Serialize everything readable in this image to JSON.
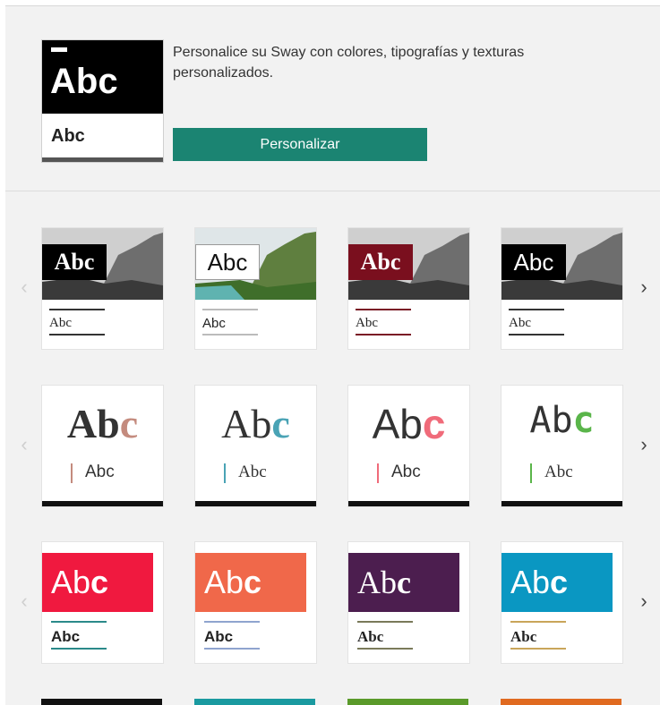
{
  "header": {
    "thumb_big": "Abc",
    "thumb_small": "Abc",
    "description": "Personalice su Sway con colores, tipografías y texturas personalizados.",
    "button_label": "Personalizar",
    "button_color": "#1b8472"
  },
  "nav": {
    "prev_icon": "chevron-left-icon",
    "next_icon": "chevron-right-icon",
    "prev_glyph": "‹",
    "next_glyph": "›"
  },
  "rows": [
    {
      "cards": [
        {
          "label": "Abc",
          "sub": "Abc",
          "accent": "#333333",
          "tag_bg": "#000000"
        },
        {
          "label": "Abc",
          "sub": "Abc",
          "accent": "#bbbbbb",
          "tag_bg": "#ffffff"
        },
        {
          "label": "Abc",
          "sub": "Abc",
          "accent": "#7a1b26",
          "tag_bg": "#7a0f1e"
        },
        {
          "label": "Abc",
          "sub": "Abc",
          "accent": "#333333",
          "tag_bg": "#000000"
        }
      ]
    },
    {
      "cards": [
        {
          "label_main": "Ab",
          "label_accent": "c",
          "sub": "Abc",
          "accent": "#c48b7e"
        },
        {
          "label_main": "Ab",
          "label_accent": "c",
          "sub": "Abc",
          "accent": "#4aa3b5"
        },
        {
          "label_main": "Ab",
          "label_accent": "c",
          "sub": "Abc",
          "accent": "#f06b7a"
        },
        {
          "label_main": "Ab",
          "label_accent": "c",
          "sub": "Abc",
          "accent": "#5ab54a"
        }
      ]
    },
    {
      "cards": [
        {
          "label_main": "Ab",
          "label_accent": "c",
          "sub": "Abc",
          "block": "#f0193f",
          "accent": "#2b8a8a"
        },
        {
          "label_main": "Ab",
          "label_accent": "c",
          "sub": "Abc",
          "block": "#f0684a",
          "accent": "#8fa4cf"
        },
        {
          "label_main": "Ab",
          "label_accent": "c",
          "sub": "Abc",
          "block": "#4c1e4f",
          "accent": "#7a7a5a"
        },
        {
          "label_main": "Ab",
          "label_accent": "c",
          "sub": "Abc",
          "block": "#0a97c2",
          "accent": "#c9a55a"
        }
      ]
    }
  ],
  "peek_colors": [
    "#111111",
    "#1a9aa0",
    "#5a9a2a",
    "#e06a20"
  ]
}
